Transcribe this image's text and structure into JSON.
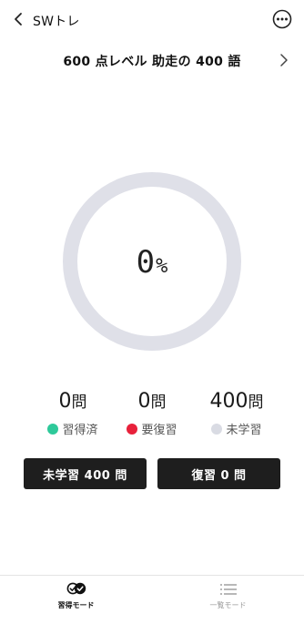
{
  "nav": {
    "title": "SWトレ"
  },
  "header": {
    "course_title": "600 点レベル 助走の 400 語"
  },
  "progress": {
    "value": "0",
    "unit": "%",
    "percent": 0,
    "ring_color": "#dfe0e8"
  },
  "stats": [
    {
      "count": "0",
      "unit": "問",
      "label": "習得済",
      "color": "#2ec99a"
    },
    {
      "count": "0",
      "unit": "問",
      "label": "要復習",
      "color": "#e8213b"
    },
    {
      "count": "400",
      "unit": "問",
      "label": "未学習",
      "color": "#d9dbe3"
    }
  ],
  "actions": {
    "unlearned_label": "未学習 400 問",
    "review_label": "復習 0 問"
  },
  "tabs": [
    {
      "label": "習得モード",
      "icon": "double-check-icon",
      "active": true
    },
    {
      "label": "一覧モード",
      "icon": "list-icon",
      "active": false
    }
  ],
  "colors": {
    "button_bg": "#1e1e1e",
    "tab_inactive": "#9a9a9a"
  }
}
